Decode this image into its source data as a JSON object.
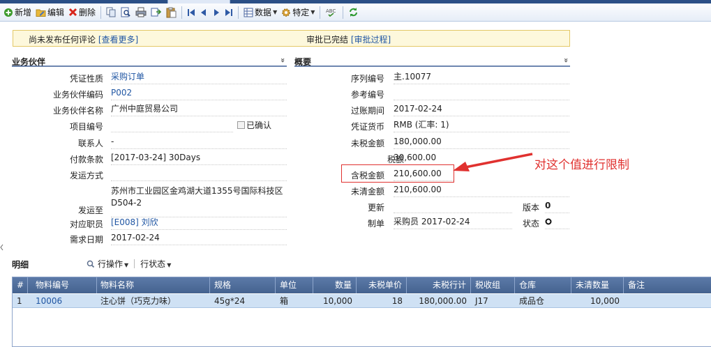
{
  "toolbar": {
    "new_label": "新增",
    "edit_label": "编辑",
    "delete_label": "删除",
    "data_label": "数据",
    "special_label": "特定"
  },
  "info_bar": {
    "comment_text": "尚未发布任何评论",
    "view_more": "[查看更多]",
    "approval_text": "审批已完结",
    "approval_process": "[审批过程]"
  },
  "sections": {
    "partner_title": "业务伙伴",
    "overview_title": "概要",
    "collapse_glyph": "»"
  },
  "partner": {
    "voucher_nature_label": "凭证性质",
    "voucher_nature_value": "采购订单",
    "partner_code_label": "业务伙伴编码",
    "partner_code_value": "P002",
    "partner_name_label": "业务伙伴名称",
    "partner_name_value": "广州中庭贸易公司",
    "project_no_label": "项目编号",
    "confirmed_label": "已确认",
    "contact_label": "联系人",
    "contact_value": "-",
    "payment_terms_label": "付款条款",
    "payment_terms_value": "[2017-03-24] 30Days",
    "shipping_method_label": "发运方式",
    "ship_to_label": "发运至",
    "ship_to_line1": "苏州市工业园区金鸡湖大道1355号国际科技区",
    "ship_to_line2": "D504-2",
    "staff_label": "对应职员",
    "staff_value": "[E008] 刘欣",
    "need_date_label": "需求日期",
    "need_date_value": "2017-02-24"
  },
  "overview": {
    "serial_label": "序列编号",
    "serial_value": "主.10077",
    "ref_label": "参考编号",
    "posting_label": "过账期间",
    "posting_value": "2017-02-24",
    "currency_label": "凭证货币",
    "currency_value": "RMB (汇率: 1)",
    "pretax_label": "未税金额",
    "pretax_value": "180,000.00",
    "tax_label": "税额",
    "tax_value": "30,600.00",
    "total_label": "含税金额",
    "total_value": "210,600.00",
    "open_label": "未清金额",
    "open_value": "210,600.00",
    "update_label": "更新",
    "version_label": "版本",
    "version_value": "0",
    "maker_label": "制单",
    "maker_value": "采购员 2017-02-24",
    "status_label": "状态"
  },
  "annotation": {
    "text": "对这个值进行限制",
    "color": "#e0312f"
  },
  "detail": {
    "title": "明细",
    "row_ops": "行操作",
    "row_status": "行状态",
    "columns": [
      "#",
      "物料编号",
      "物料名称",
      "规格",
      "单位",
      "数量",
      "未税单价",
      "未税行计",
      "税收组",
      "仓库",
      "未清数量",
      "备注"
    ],
    "rows": [
      {
        "idx": "1",
        "code": "10006",
        "name": "注心饼（巧克力味）",
        "spec": "45g*24",
        "unit": "箱",
        "qty": "10,000",
        "price": "18",
        "line_total": "180,000.00",
        "tax_group": "J17",
        "warehouse": "成品仓",
        "open_qty": "10,000",
        "note": ""
      }
    ]
  }
}
